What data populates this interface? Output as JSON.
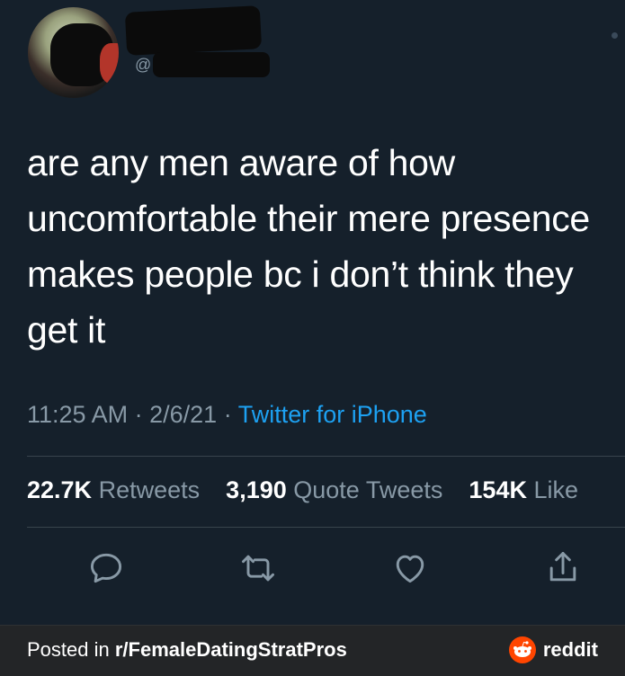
{
  "tweet": {
    "handle": "@",
    "text": "are any men aware of how uncomfortable their mere presence makes people bc i don’t think they get it",
    "time": "11:25 AM",
    "date": "2/6/21",
    "source": "Twitter for iPhone",
    "stats": {
      "retweets_count": "22.7K",
      "retweets_label": "Retweets",
      "quotes_count": "3,190",
      "quotes_label": "Quote Tweets",
      "likes_count": "154K",
      "likes_label": "Like"
    }
  },
  "footer": {
    "posted_prefix": "Posted in",
    "subreddit": "r/FemaleDatingStratPros",
    "brand": "reddit",
    "brand_color": "#ff4500"
  },
  "colors": {
    "background": "#15202b",
    "text": "#ffffff",
    "muted": "#8899a6",
    "link": "#1da1f2"
  }
}
